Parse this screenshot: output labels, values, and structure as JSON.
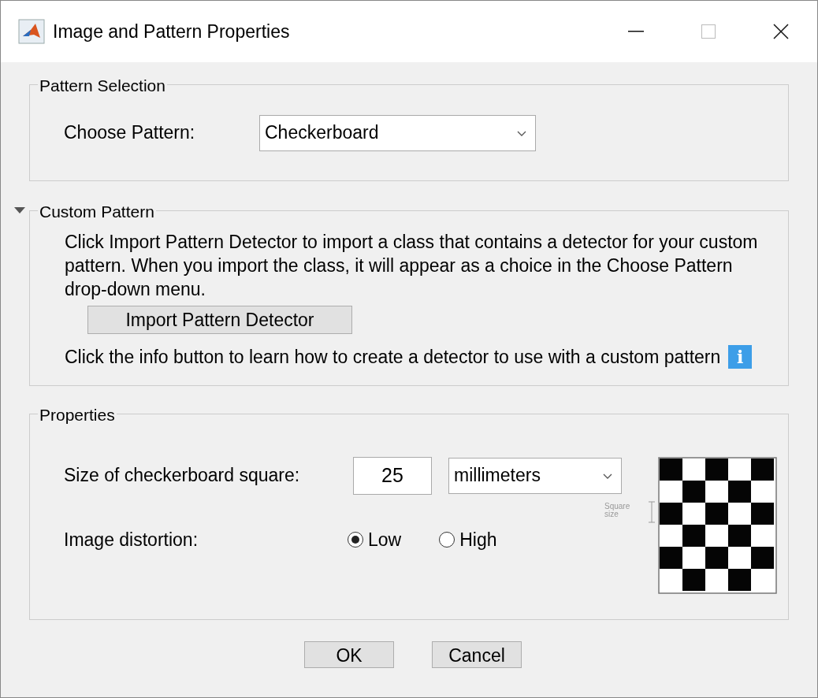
{
  "window": {
    "title": "Image and Pattern Properties"
  },
  "pattern_selection": {
    "title": "Pattern Selection",
    "label": "Choose Pattern:",
    "value": "Checkerboard"
  },
  "custom_pattern": {
    "title": "Custom Pattern",
    "expanded": true,
    "description": "Click Import Pattern Detector to import a class that contains a detector for your custom pattern. When you import the class, it will appear as a choice in the Choose Pattern drop-down menu.",
    "import_button": "Import Pattern Detector",
    "info_text": "Click the info button to learn how to create a detector to use with a custom pattern",
    "info_icon": "i"
  },
  "properties": {
    "title": "Properties",
    "size_label": "Size of checkerboard square:",
    "size_value": "25",
    "units": "millimeters",
    "distortion_label": "Image distortion:",
    "distortion_options": [
      {
        "label": "Low",
        "selected": true
      },
      {
        "label": "High",
        "selected": false
      }
    ],
    "diagram_label": "Square size"
  },
  "buttons": [
    "OK",
    "Cancel"
  ]
}
